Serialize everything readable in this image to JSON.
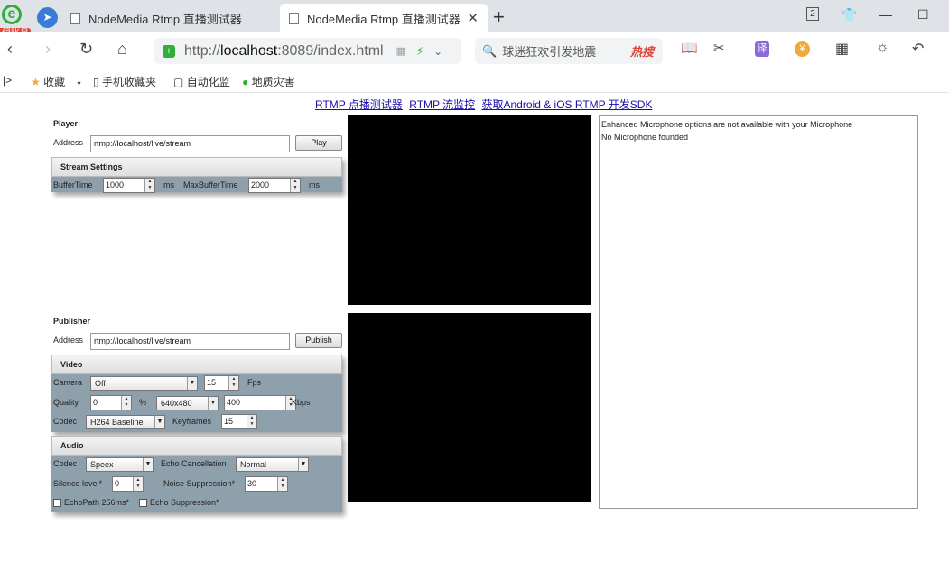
{
  "browser": {
    "account_badge": "绿账号",
    "tabs": [
      {
        "title": "NodeMedia Rtmp 直播测试器",
        "active": false
      },
      {
        "title": "NodeMedia Rtmp 直播测试器",
        "active": true
      }
    ],
    "tab_count": "2",
    "url": {
      "prefix": "http://",
      "host": "localhost",
      "rest": ":8089/index.html"
    },
    "search": {
      "placeholder": "球迷狂欢引发地震",
      "hot_label": "热搜"
    },
    "translate_label": "译",
    "bookmarks": [
      {
        "label": "收藏"
      },
      {
        "label": "手机收藏夹"
      },
      {
        "label": "自动化监"
      },
      {
        "label": "地质灾害"
      }
    ]
  },
  "page": {
    "links": [
      "RTMP 点播测试器",
      "RTMP 流监控",
      "获取Android & iOS RTMP 开发SDK"
    ],
    "player": {
      "title": "Player",
      "address_label": "Address",
      "address_value": "rtmp://localhost/live/stream",
      "play_label": "Play",
      "settings_title": "Stream Settings",
      "buffer_label": "BufferTime",
      "buffer_value": "1000",
      "ms1": "ms",
      "maxbuffer_label": "MaxBufferTime",
      "maxbuffer_value": "2000",
      "ms2": "ms"
    },
    "publisher": {
      "title": "Publisher",
      "address_label": "Address",
      "address_value": "rtmp://localhost/live/stream",
      "publish_label": "Publish",
      "video": {
        "title": "Video",
        "camera_label": "Camera",
        "camera_value": "Off",
        "fps_value": "15",
        "fps_label": "Fps",
        "quality_label": "Quality",
        "quality_value": "0",
        "percent": "%",
        "resolution_value": "640x480",
        "kbps_value": "400",
        "kbps_label": "Kbps",
        "codec_label": "Codec",
        "codec_value": "H264 Baseline",
        "keyframes_label": "Keyframes",
        "keyframes_value": "15"
      },
      "audio": {
        "title": "Audio",
        "codec_label": "Codec",
        "codec_value": "Speex",
        "echo_label": "Echo Cancellation",
        "echo_value": "Normal",
        "silence_label": "Silence level*",
        "silence_value": "0",
        "noise_label": "Noise Suppression*",
        "noise_value": "30",
        "echopath_label": "EchoPath 256ms*",
        "echosupp_label": "Echo Suppression*"
      }
    },
    "log": [
      "Enhanced Microphone options are not available with your Microphone",
      "No Microphone founded"
    ]
  }
}
